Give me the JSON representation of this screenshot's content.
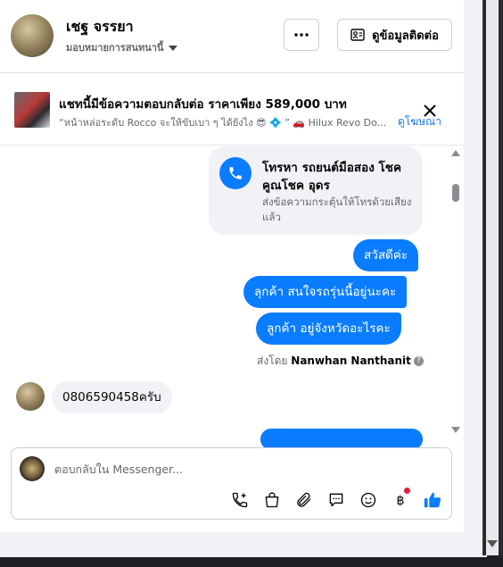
{
  "header": {
    "name": "เชฐ จรรยา",
    "assign_label": "มอบหมายการสนทนานี้",
    "contact_button": "ดูข้อมูลติดต่อ"
  },
  "ad": {
    "title": "แชทนี้มีข้อความตอบกลับต่อ ราคาเพียง 589,000 บาท",
    "subtitle": "“หน้าหล่อระดับ Rocco จะให้ขับเบา ๆ ได้ยังไง 😎 💠 ” 🚗 Hilux Revo Do...",
    "link": "ดูโฆษณา"
  },
  "messages": {
    "call_card": {
      "title": "โทรหา รถยนต์มือสอง โชคคูณโชค อุดร",
      "subtitle": "ส่งข้อความกระตุ้นให้โทรด้วยเสียงแล้ว"
    },
    "out_1": "สวัสดีค่ะ",
    "out_2": "ลุกค้า  สนใจรถรุ่นนี้อยู่นะคะ",
    "out_3": "ลูกค้า   อยู่จังหวัดอะไรคะ",
    "sent_by_prefix": "ส่งโดย",
    "sent_by_name": "Nanwhan Nanthanit",
    "in_1": "0806590458ครับ"
  },
  "composer": {
    "placeholder": "ตอบกลับใน Messenger...",
    "tools": [
      "phone-plus-icon",
      "shopping-bag-icon",
      "paperclip-icon",
      "saved-replies-icon",
      "emoji-icon",
      "baht-icon",
      "thumbs-up-icon"
    ]
  },
  "colors": {
    "accent": "#0a7cff",
    "notification": "#e41e3f"
  }
}
